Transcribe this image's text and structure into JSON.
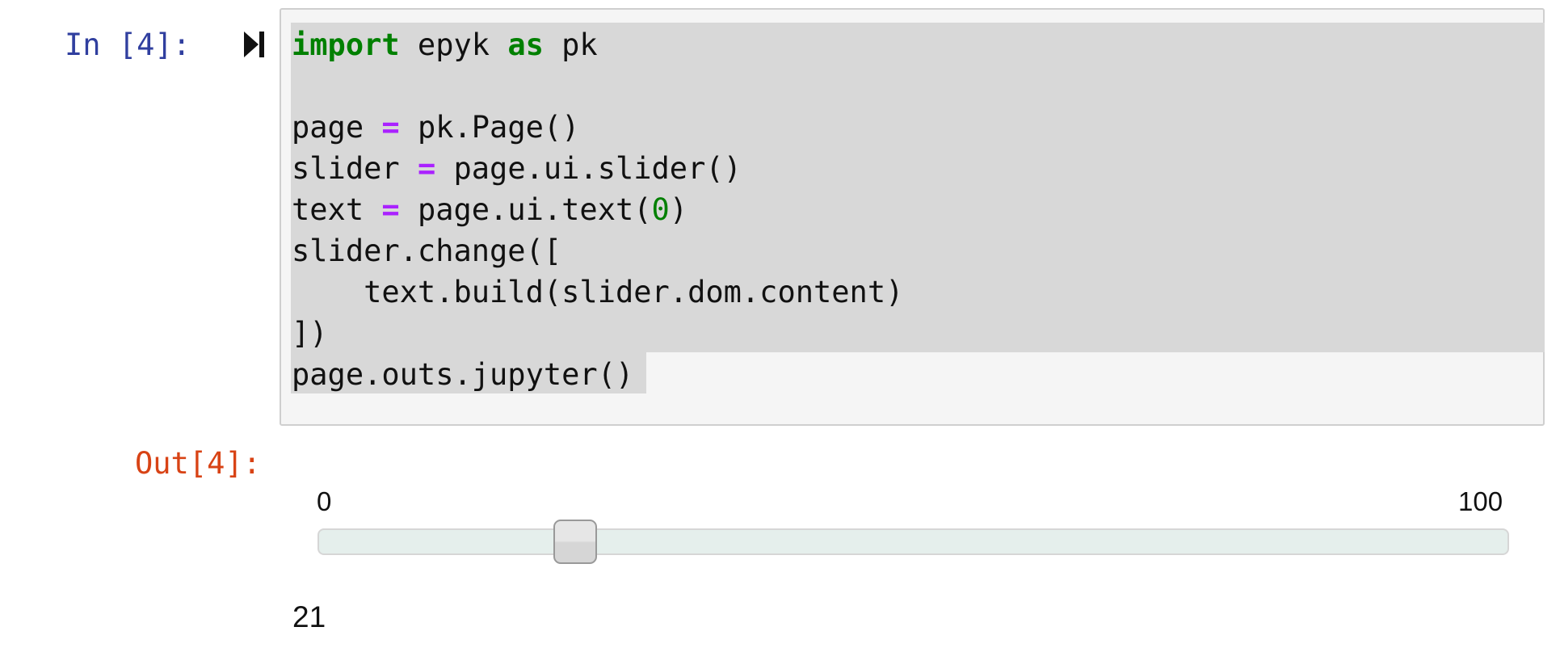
{
  "cell": {
    "in_prompt": "In [4]:",
    "out_prompt": "Out[4]:",
    "run_icon": "run-cell-icon",
    "code_lines": [
      [
        {
          "t": "import",
          "c": "kw"
        },
        {
          "t": " epyk ",
          "c": ""
        },
        {
          "t": "as",
          "c": "kw"
        },
        {
          "t": " pk",
          "c": ""
        }
      ],
      [],
      [
        {
          "t": "page ",
          "c": ""
        },
        {
          "t": "=",
          "c": "op"
        },
        {
          "t": " pk.Page()",
          "c": ""
        }
      ],
      [
        {
          "t": "slider ",
          "c": ""
        },
        {
          "t": "=",
          "c": "op"
        },
        {
          "t": " page.ui.slider()",
          "c": ""
        }
      ],
      [
        {
          "t": "text ",
          "c": ""
        },
        {
          "t": "=",
          "c": "op"
        },
        {
          "t": " page.ui.text(",
          "c": ""
        },
        {
          "t": "0",
          "c": "num"
        },
        {
          "t": ")",
          "c": ""
        }
      ],
      [
        {
          "t": "slider.change([",
          "c": ""
        }
      ],
      [
        {
          "t": "    text.build(slider.dom.content)",
          "c": ""
        }
      ],
      [
        {
          "t": "])",
          "c": ""
        }
      ],
      [
        {
          "t": "page.outs.jupyter()",
          "c": ""
        }
      ]
    ]
  },
  "output": {
    "slider": {
      "min_label": "0",
      "max_label": "100",
      "min": 0,
      "max": 100,
      "value": 21
    },
    "text_value": "21"
  },
  "colors": {
    "in_prompt": "#303f9f",
    "out_prompt": "#d84315",
    "keyword": "#008000",
    "operator": "#aa22ff",
    "number": "#008000"
  }
}
